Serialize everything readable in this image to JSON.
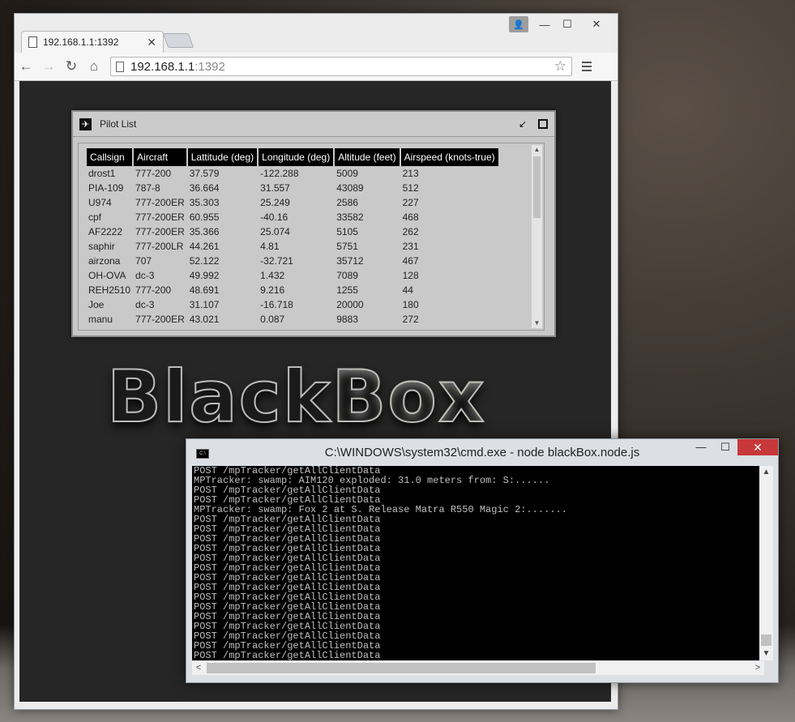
{
  "browser": {
    "tab_title": "192.168.1.1:1392",
    "tab_close": "✕",
    "url_host": "192.168.1.1",
    "url_port": ":1392",
    "back": "←",
    "forward": "→",
    "reload": "↻",
    "home": "⌂",
    "star": "☆",
    "window_buttons": {
      "minimize": "—",
      "maximize": "☐",
      "close": "✕",
      "user": "👤"
    }
  },
  "pilot_list": {
    "title": "Pilot List",
    "columns": [
      "Callsign",
      "Aircraft",
      "Lattitude (deg)",
      "Longitude (deg)",
      "Altitude (feet)",
      "Airspeed (knots-true)"
    ],
    "rows": [
      [
        "drost1",
        "777-200",
        "37.579",
        "-122.288",
        "5009",
        "213"
      ],
      [
        "PIA-109",
        "787-8",
        "36.664",
        "31.557",
        "43089",
        "512"
      ],
      [
        "U974",
        "777-200ER",
        "35.303",
        "25.249",
        "2586",
        "227"
      ],
      [
        "cpf",
        "777-200ER",
        "60.955",
        "-40.16",
        "33582",
        "468"
      ],
      [
        "AF2222",
        "777-200ER",
        "35.366",
        "25.074",
        "5105",
        "262"
      ],
      [
        "saphir",
        "777-200LR",
        "44.261",
        "4.81",
        "5751",
        "231"
      ],
      [
        "airzona",
        "707",
        "52.122",
        "-32.721",
        "35712",
        "467"
      ],
      [
        "OH-OVA",
        "dc-3",
        "49.992",
        "1.432",
        "7089",
        "128"
      ],
      [
        "REH2510",
        "777-200",
        "48.691",
        "9.216",
        "1255",
        "44"
      ],
      [
        "Joe",
        "dc-3",
        "31.107",
        "-16.718",
        "20000",
        "180"
      ],
      [
        "manu",
        "777-200ER",
        "43.021",
        "0.087",
        "9883",
        "272"
      ]
    ]
  },
  "logo": {
    "part1": "Black",
    "part2": "Box"
  },
  "console": {
    "title": "C:\\WINDOWS\\system32\\cmd.exe - node  blackBox.node.js",
    "icon_text": "C:\\",
    "lines": [
      "POST /mpTracker/getAllClientData",
      "MPTracker: swamp: AIM120 exploded: 31.0 meters from: S:......",
      "POST /mpTracker/getAllClientData",
      "POST /mpTracker/getAllClientData",
      "MPTracker: swamp: Fox 2 at S. Release Matra R550 Magic 2:.......",
      "POST /mpTracker/getAllClientData",
      "POST /mpTracker/getAllClientData",
      "POST /mpTracker/getAllClientData",
      "POST /mpTracker/getAllClientData",
      "POST /mpTracker/getAllClientData",
      "POST /mpTracker/getAllClientData",
      "POST /mpTracker/getAllClientData",
      "POST /mpTracker/getAllClientData",
      "POST /mpTracker/getAllClientData",
      "POST /mpTracker/getAllClientData",
      "POST /mpTracker/getAllClientData",
      "POST /mpTracker/getAllClientData",
      "POST /mpTracker/getAllClientData",
      "POST /mpTracker/getAllClientData",
      "POST /mpTracker/getAllClientData"
    ],
    "buttons": {
      "minimize": "—",
      "maximize": "☐",
      "close": "✕"
    }
  }
}
